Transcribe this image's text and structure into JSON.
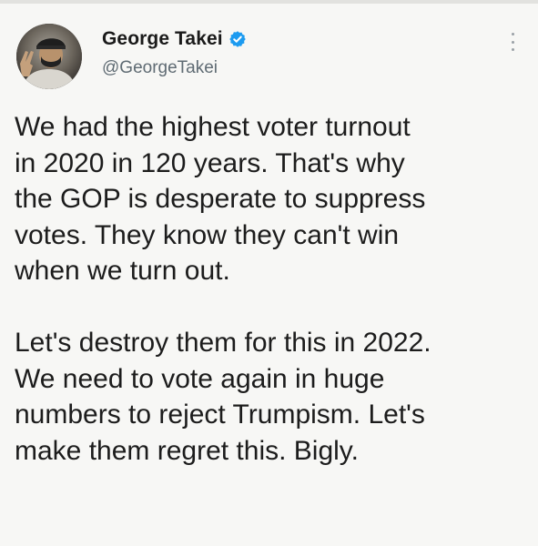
{
  "tweet": {
    "author": {
      "display_name": "George Takei",
      "handle": "@GeorgeTakei",
      "verified_icon": "verified-badge-icon",
      "avatar_icon": "avatar"
    },
    "menu_icon": "more-options-icon",
    "paragraphs": [
      {
        "lines": [
          "We had the highest voter turnout",
          "in 2020 in 120 years. That's why",
          "the GOP is desperate to suppress",
          "votes. They know they can't win",
          "when we turn out."
        ]
      },
      {
        "lines": [
          "Let's destroy them for this in 2022.",
          "We need to vote again in huge",
          "numbers to reject Trumpism. Let's",
          "make them regret this. Bigly."
        ]
      }
    ]
  },
  "colors": {
    "verified": "#1d9bf0",
    "text": "#1c1c1c",
    "handle": "#5f6b73",
    "background": "#f7f7f5"
  }
}
